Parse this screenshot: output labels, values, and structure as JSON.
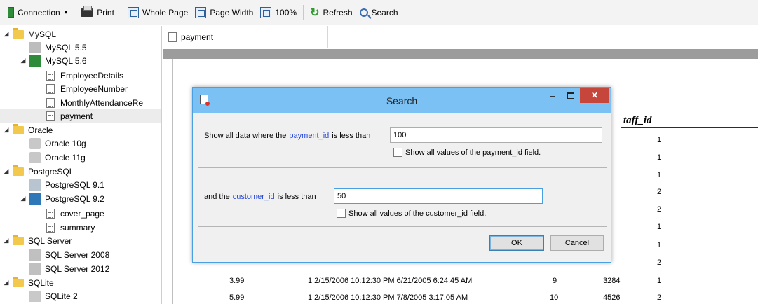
{
  "toolbar": {
    "connection": "Connection",
    "print": "Print",
    "whole_page": "Whole Page",
    "page_width": "Page Width",
    "zoom": "100%",
    "refresh": "Refresh",
    "search": "Search"
  },
  "tree": {
    "mysql": "MySQL",
    "mysql55": "MySQL 5.5",
    "mysql56": "MySQL 5.6",
    "employee_details": "EmployeeDetails",
    "employee_number": "EmployeeNumber",
    "monthly_attendance": "MonthlyAttendanceRe",
    "payment": "payment",
    "oracle": "Oracle",
    "oracle10g": "Oracle 10g",
    "oracle11g": "Oracle 11g",
    "postgresql": "PostgreSQL",
    "pg91": "PostgreSQL 9.1",
    "pg92": "PostgreSQL 9.2",
    "cover_page": "cover_page",
    "summary": "summary",
    "sqlserver": "SQL Server",
    "ss2008": "SQL Server 2008",
    "ss2012": "SQL Server 2012",
    "sqlite": "SQLite",
    "sqlite2": "SQLite 2"
  },
  "document": {
    "tab_label": "payment",
    "column_header": "taff_id",
    "staff_ids": [
      "1",
      "1",
      "1",
      "2",
      "2",
      "1",
      "1",
      "2",
      "1",
      "2"
    ],
    "rows": [
      {
        "amount": "3.99",
        "line": "1 2/15/2006 10:12:30 PM 6/21/2005 6:24:45 AM",
        "a": "9",
        "b": "3284"
      },
      {
        "amount": "5.99",
        "line": "1 2/15/2006 10:12:30 PM 7/8/2005 3:17:05 AM",
        "a": "10",
        "b": "4526"
      }
    ]
  },
  "dialog": {
    "title": "Search",
    "cond1_prefix": "Show all data where the",
    "cond1_field": "payment_id",
    "cond1_op": "is less than",
    "cond1_value": "100",
    "cond1_checkbox": "Show all values of the payment_id field.",
    "cond2_prefix": "and the",
    "cond2_field": "customer_id",
    "cond2_op": "is less than",
    "cond2_value": "50",
    "cond2_checkbox": "Show all values of the customer_id field.",
    "ok": "OK",
    "cancel": "Cancel",
    "minimize": "–",
    "close": "✕"
  }
}
